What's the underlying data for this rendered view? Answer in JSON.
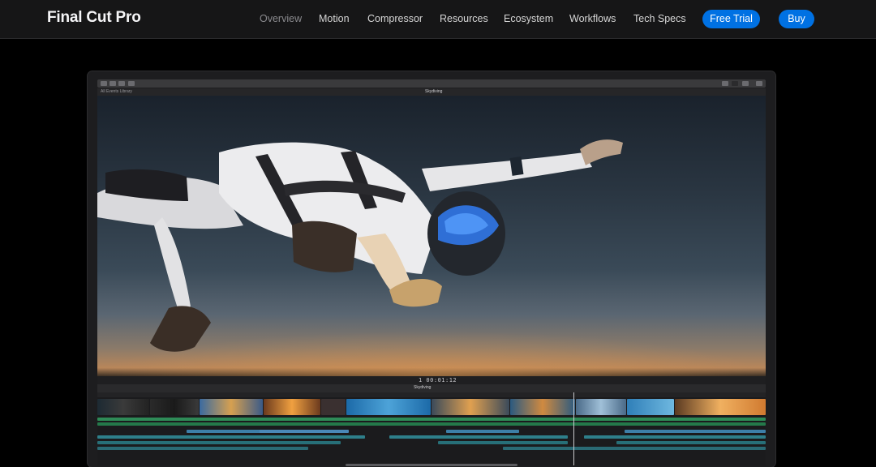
{
  "nav": {
    "brand": "Final Cut Pro",
    "links": [
      "Overview",
      "Motion",
      "Compressor",
      "Resources",
      "Ecosystem",
      "Workflows",
      "Tech Specs"
    ],
    "active_link": "Overview",
    "free_trial_label": "Free Trial",
    "buy_label": "Buy"
  },
  "app": {
    "viewer_title": "Skydiving",
    "left_label": "All Events  Library",
    "timecode": "1 00:01:12",
    "timeline_project": "Skydiving"
  },
  "colors": {
    "accent": "#0071e3",
    "nav_bg": "#161617",
    "timeline_green": "#2e8b57",
    "timeline_blue": "#3d7fa8"
  }
}
